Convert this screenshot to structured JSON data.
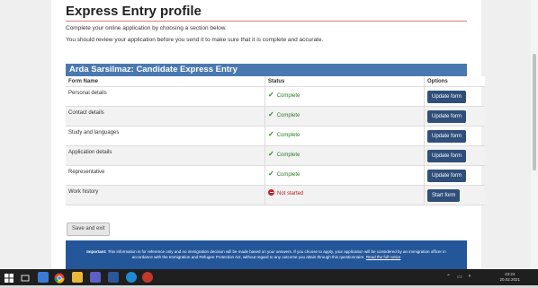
{
  "page": {
    "title": "Express Entry profile",
    "intro1": "Complete your online application by choosing a section below.",
    "intro2": "You should review your application before you send it to make sure that it is complete and accurate."
  },
  "panel": {
    "title": "Arda Sarsilmaz: Candidate Express Entry",
    "headers": {
      "form": "Form Name",
      "status": "Status",
      "options": "Options"
    },
    "rows": [
      {
        "form": "Personal details",
        "status": "Complete",
        "button": "Update form"
      },
      {
        "form": "Contact details",
        "status": "Complete",
        "button": "Update form"
      },
      {
        "form": "Study and languages",
        "status": "Complete",
        "button": "Update form"
      },
      {
        "form": "Application details",
        "status": "Complete",
        "button": "Update form"
      },
      {
        "form": "Representative",
        "status": "Complete",
        "button": "Update form"
      },
      {
        "form": "Work history",
        "status": "Not started",
        "button": "Start form"
      }
    ]
  },
  "actions": {
    "save_exit": "Save and exit"
  },
  "notice": {
    "label": "Important:",
    "text": "This information is for reference only and no immigration decision will be made based on your answers. If you choose to apply, your application will be considered by an immigration officer in accordance with the Immigration and Refugee Protection Act, without regard to any outcome you attain through this questionnaire.",
    "link": "Read the full notice"
  },
  "taskbar": {
    "time": "23:24",
    "date": "20.02.2021",
    "icons": [
      "windows-icon",
      "search-icon",
      "task-view-icon",
      "file-explorer-icon",
      "chrome-icon",
      "folder-icon",
      "teams-icon",
      "word-icon",
      "edge-icon",
      "app-icon"
    ]
  },
  "colors": {
    "header_blue": "#4a79b1",
    "button_navy": "#2f4f7a",
    "complete_green": "#2d7d2d",
    "notstarted_red": "#b52020",
    "notice_blue": "#24569a"
  }
}
